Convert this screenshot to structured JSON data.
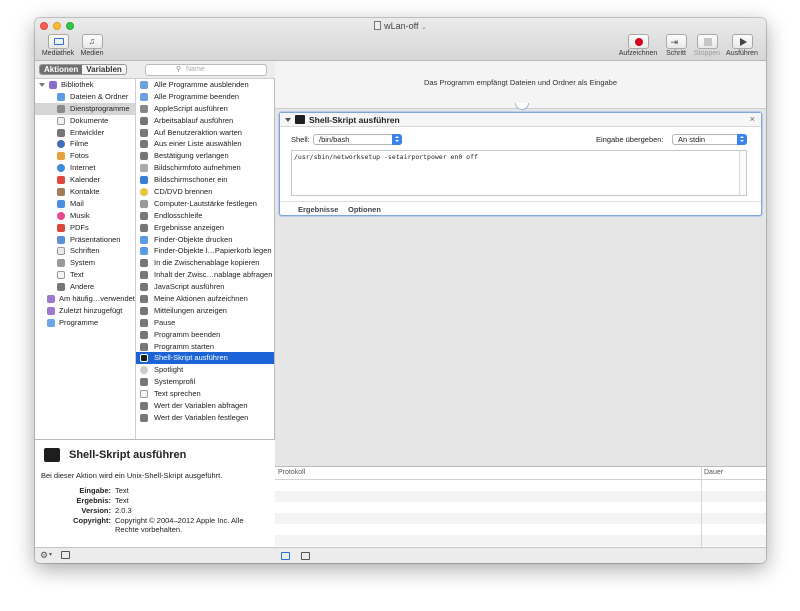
{
  "window": {
    "title": "wLan-off"
  },
  "toolbar": {
    "left": [
      {
        "label": "Mediathek",
        "icon": "library-icon"
      },
      {
        "label": "Medien",
        "icon": "media-icon"
      }
    ],
    "right": [
      {
        "label": "Aufzeichnen",
        "icon": "record-icon"
      },
      {
        "label": "Schritt",
        "icon": "step-icon"
      },
      {
        "label": "Stoppen",
        "icon": "stop-icon"
      },
      {
        "label": "Ausführen",
        "icon": "play-icon"
      }
    ]
  },
  "library_tabs": {
    "actions": "Aktionen",
    "variables": "Variablen"
  },
  "search": {
    "placeholder": "Name"
  },
  "library": {
    "root": "Bibliothek",
    "items": [
      "Dateien & Ordner",
      "Dienstprogramme",
      "Dokumente",
      "Entwickler",
      "Filme",
      "Fotos",
      "Internet",
      "Kalender",
      "Kontakte",
      "Mail",
      "Musik",
      "PDFs",
      "Präsentationen",
      "Schriften",
      "System",
      "Text",
      "Andere"
    ],
    "groups": [
      "Am häufig…verwendet",
      "Zuletzt hinzugefügt",
      "Programme"
    ]
  },
  "actions": [
    "Alle Programme ausblenden",
    "Alle Programme beenden",
    "AppleScript ausführen",
    "Arbeitsablauf ausführen",
    "Auf Benutzeraktion warten",
    "Aus einer Liste auswählen",
    "Bestätigung verlangen",
    "Bildschirmfoto aufnehmen",
    "Bildschirmschoner ein",
    "CD/DVD brennen",
    "Computer-Lautstärke festlegen",
    "Endlosschleife",
    "Ergebnisse anzeigen",
    "Finder-Objekte drucken",
    "Finder-Objekte l…Papierkorb legen",
    "In die Zwischenablage kopieren",
    "Inhalt der Zwisc…nablage abfragen",
    "JavaScript ausführen",
    "Meine Aktionen aufzeichnen",
    "Mitteilungen anzeigen",
    "Pause",
    "Programm beenden",
    "Programm starten",
    "Shell-Skript ausführen",
    "Spotlight",
    "Systemprofil",
    "Text sprechen",
    "Wert der Variablen abfragen",
    "Wert der Variablen festlegen"
  ],
  "description": {
    "title": "Shell-Skript ausführen",
    "text": "Bei dieser Aktion wird ein Unix-Shell-Skript ausgeführt.",
    "input_label": "Eingabe:",
    "input_value": "Text",
    "result_label": "Ergebnis:",
    "result_value": "Text",
    "version_label": "Version:",
    "version_value": "2.0.3",
    "copyright_label": "Copyright:",
    "copyright_value": "Copyright © 2004–2012 Apple Inc. Alle Rechte vorbehalten."
  },
  "workflow": {
    "header": "Das Programm empfängt Dateien und Ordner als Eingabe",
    "card": {
      "title": "Shell-Skript ausführen",
      "shell_label": "Shell:",
      "shell_value": "/bin/bash",
      "input_label": "Eingabe übergeben:",
      "input_value": "An stdin",
      "script": "/usr/sbin/networksetup -setairportpower en0 off",
      "tab_results": "Ergebnisse",
      "tab_options": "Optionen",
      "close": "×"
    }
  },
  "log": {
    "col_protocol": "Protokoll",
    "col_duration": "Dauer"
  },
  "colors": {
    "selection": "#1b63d6",
    "record": "#d0021b",
    "popup": "#3b82f2"
  }
}
